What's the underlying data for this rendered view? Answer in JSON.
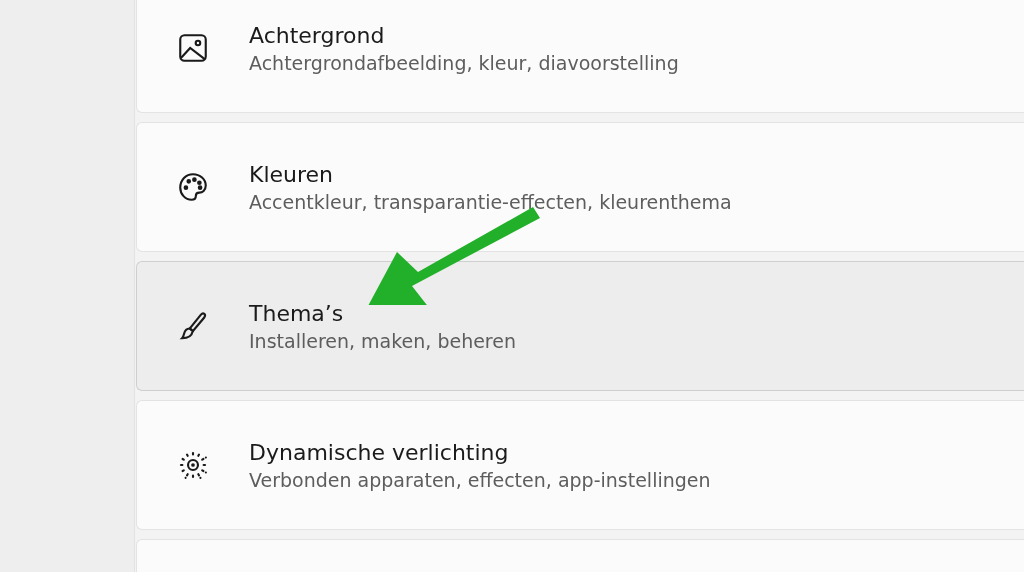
{
  "settings": [
    {
      "kind": "picture",
      "title": "Achtergrond",
      "subtitle": "Achtergrondafbeelding, kleur, diavoorstelling",
      "highlighted": false
    },
    {
      "kind": "palette",
      "title": "Kleuren",
      "subtitle": "Accentkleur, transparantie-effecten, kleurenthema",
      "highlighted": false
    },
    {
      "kind": "brush",
      "title": "Thema’s",
      "subtitle": "Installeren, maken, beheren",
      "highlighted": true
    },
    {
      "kind": "light",
      "title": "Dynamische verlichting",
      "subtitle": "Verbonden apparaten, effecten, app-instellingen",
      "highlighted": false
    }
  ]
}
